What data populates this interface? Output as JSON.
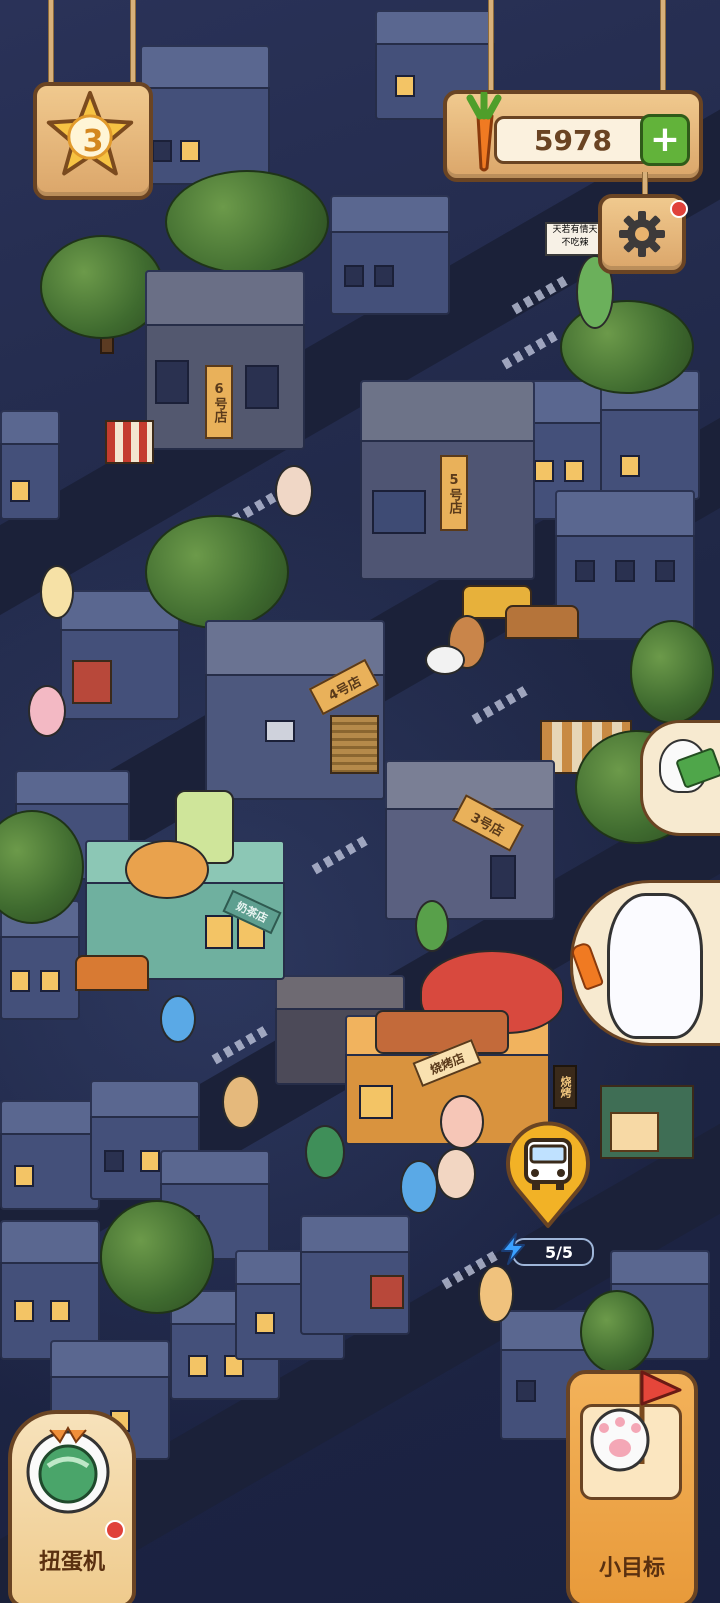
{
  "hud": {
    "level": "3",
    "carrots": "5978",
    "add_symbol": "+"
  },
  "stores": {
    "store4": "4号店",
    "store5": "5号店",
    "store6": "6号店",
    "store3": "3号店",
    "milk_tea": "奶茶店",
    "bbq": "烧烤店",
    "bbq_side": "烧烤"
  },
  "street_sign": {
    "line1": "天若有情天",
    "line2": "不吃辣"
  },
  "energy": {
    "value": "5/5"
  },
  "bottom": {
    "left_label": "扭蛋机",
    "right_label": "小目标"
  },
  "colors": {
    "wood": "#e9b36e",
    "wood_border": "#6a4423",
    "plus_green": "#62b33a",
    "bus_yellow": "#f2b226",
    "energy_blue": "#3aa0ff",
    "night_bg": "#1f2746"
  },
  "icons": {
    "level": "star-badge-icon",
    "currency": "carrot-icon",
    "add": "plus-icon",
    "settings": "gear-icon",
    "bus": "bus-icon",
    "energy": "lightning-icon",
    "gacha": "capsule-machine-icon",
    "goal": "flag-paw-icon"
  }
}
